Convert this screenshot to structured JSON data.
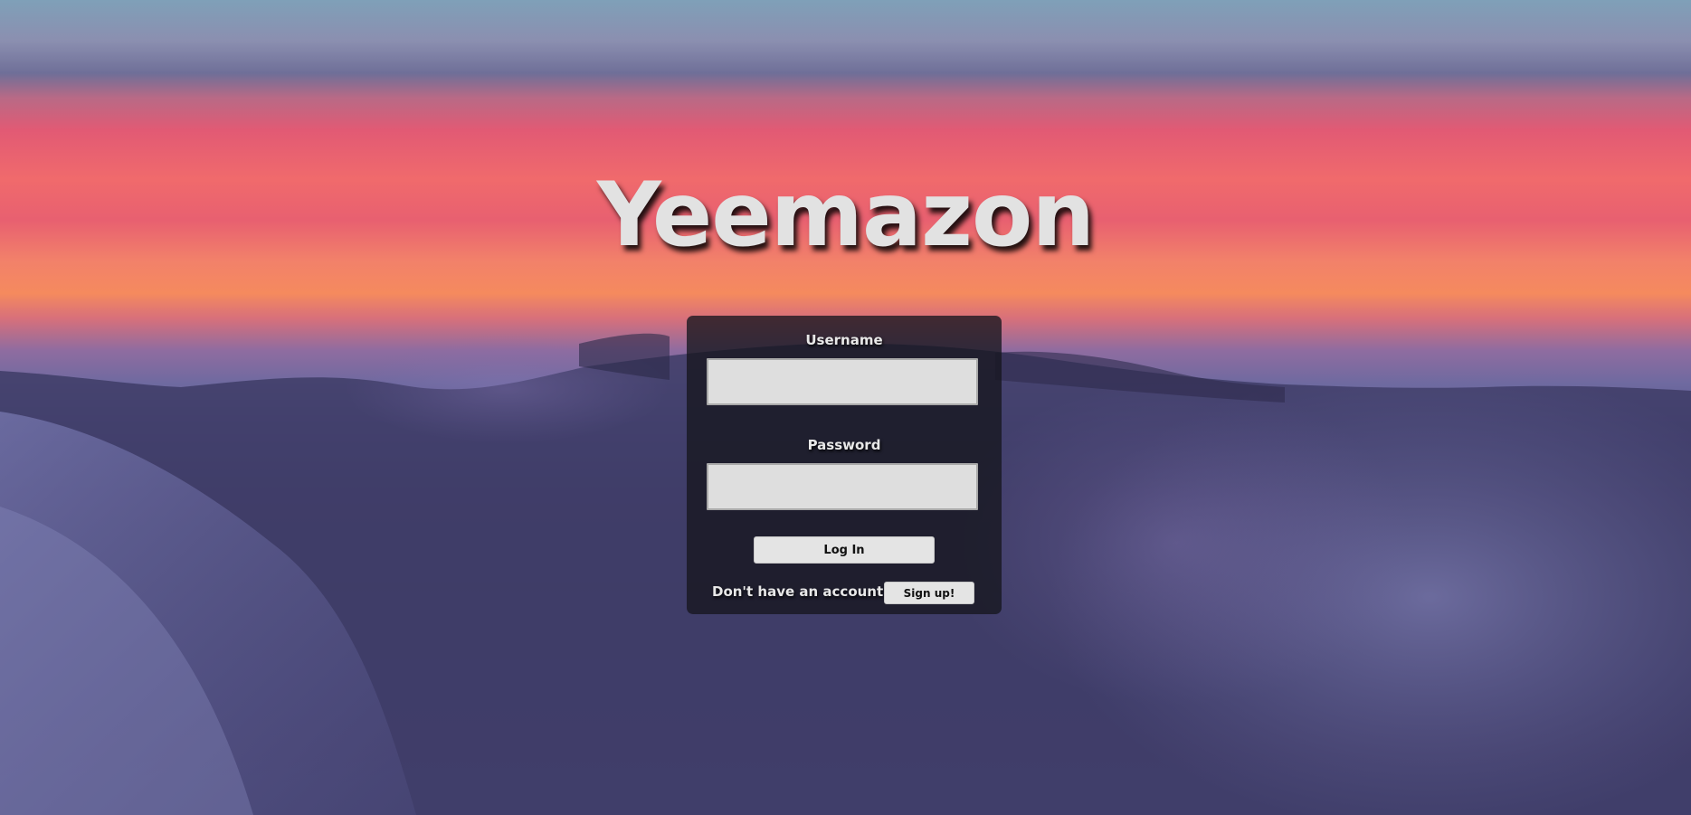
{
  "app": {
    "title": "Yeemazon"
  },
  "login_form": {
    "username_label": "Username",
    "username_value": "",
    "password_label": "Password",
    "password_value": "",
    "login_button": "Log In",
    "signup_prompt": "Don't have an account?",
    "signup_button": "Sign up!"
  }
}
